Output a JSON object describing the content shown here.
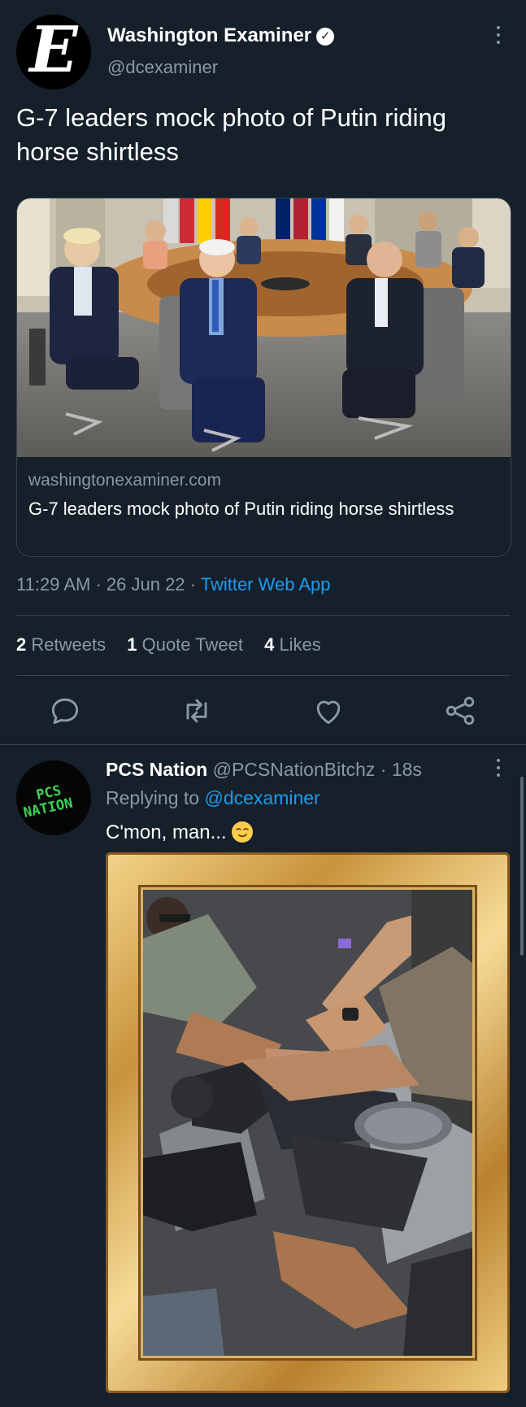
{
  "main_tweet": {
    "author": {
      "name": "Washington Examiner",
      "handle": "@dcexaminer",
      "avatar_letter": "E",
      "verified_icon": "verified-check-icon"
    },
    "text": "G-7 leaders mock photo of Putin riding horse shirtless",
    "card": {
      "domain": "washingtonexaminer.com",
      "title": "G-7 leaders mock photo of Putin riding horse shirtless",
      "image": "photo of G-7 leaders seated at round table"
    },
    "meta": {
      "time": "11:29 AM",
      "separator": "·",
      "date": "26 Jun 22",
      "source": "Twitter Web App"
    },
    "stats": {
      "retweets_count": "2",
      "retweets_label": "Retweets",
      "quotes_count": "1",
      "quotes_label": "Quote Tweet",
      "likes_count": "4",
      "likes_label": "Likes"
    },
    "actions": [
      "reply-icon",
      "retweet-icon",
      "like-icon",
      "share-icon"
    ]
  },
  "reply": {
    "author": {
      "name": "PCS Nation",
      "handle": "@PCSNationBitchz",
      "time": "· 18s",
      "avatar_text_line1": "PCS",
      "avatar_text_line2": "NATION"
    },
    "replying_prefix": "Replying to",
    "replying_to": "@dcexaminer",
    "text": "C'mon, man...",
    "emoji": "smirking-face-emoji",
    "image": "photo in ornate gold frame"
  },
  "colors": {
    "background": "#15202b",
    "muted": "#8b98a5",
    "link": "#1d9bf0",
    "border": "#38444d",
    "pcs_green": "#39d353"
  }
}
